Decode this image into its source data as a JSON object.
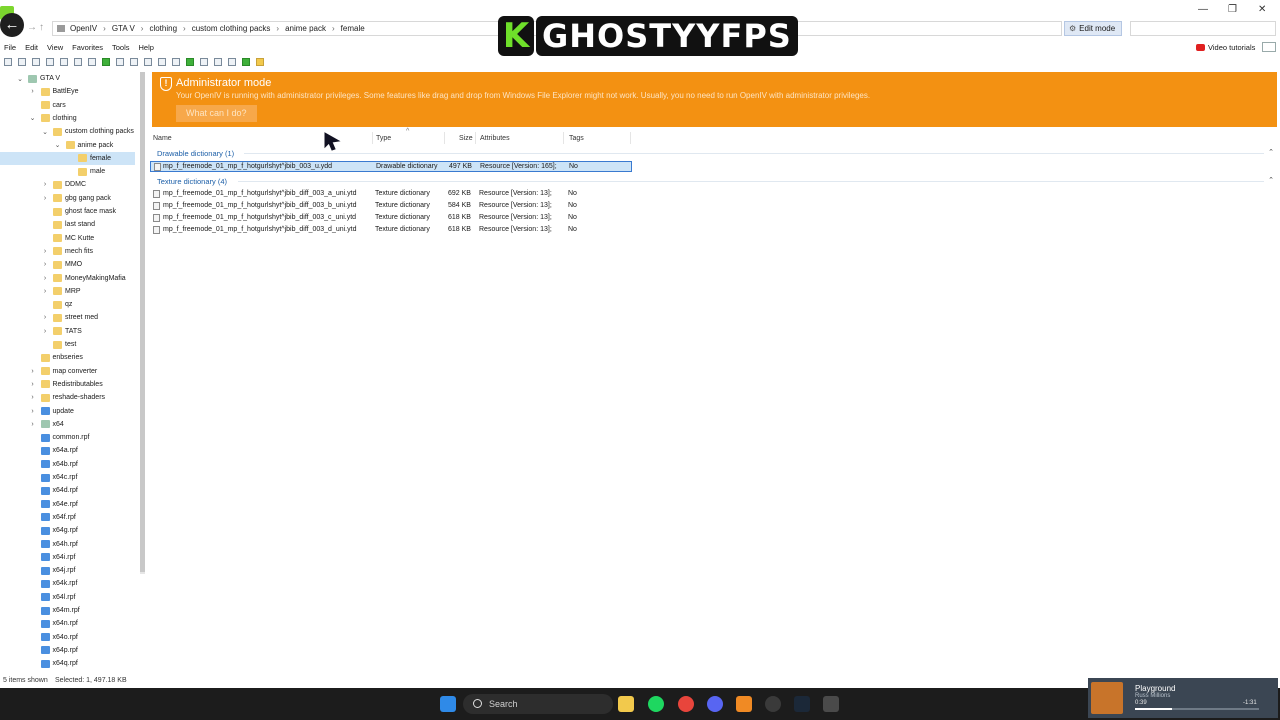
{
  "titlebar": {
    "breadcrumb": [
      "OpenIV",
      "GTA V",
      "clothing",
      "custom clothing packs",
      "anime pack",
      "female"
    ],
    "edit_mode": "Edit mode",
    "window_controls": [
      "—",
      "❐",
      "✕"
    ]
  },
  "watermark": {
    "logo_letter": "K",
    "text": "GHOSTYYFPS"
  },
  "menu": [
    "File",
    "Edit",
    "View",
    "Favorites",
    "Tools",
    "Help"
  ],
  "video_tutorials": "Video tutorials",
  "tree": [
    {
      "label": "GTA V",
      "depth": 0,
      "chev": "⌄",
      "kind": "sys"
    },
    {
      "label": "BattlEye",
      "depth": 1,
      "chev": "›",
      "kind": "folder"
    },
    {
      "label": "cars",
      "depth": 1,
      "chev": "",
      "kind": "folder"
    },
    {
      "label": "clothing",
      "depth": 1,
      "chev": "⌄",
      "kind": "folder"
    },
    {
      "label": "custom clothing packs",
      "depth": 2,
      "chev": "⌄",
      "kind": "folder"
    },
    {
      "label": "anime pack",
      "depth": 3,
      "chev": "⌄",
      "kind": "folder"
    },
    {
      "label": "female",
      "depth": 4,
      "chev": "",
      "kind": "folder",
      "selected": true
    },
    {
      "label": "male",
      "depth": 4,
      "chev": "",
      "kind": "folder"
    },
    {
      "label": "DDMC",
      "depth": 2,
      "chev": "›",
      "kind": "folder"
    },
    {
      "label": "gbg gang pack",
      "depth": 2,
      "chev": "›",
      "kind": "folder"
    },
    {
      "label": "ghost face mask",
      "depth": 2,
      "chev": "",
      "kind": "folder"
    },
    {
      "label": "last stand",
      "depth": 2,
      "chev": "",
      "kind": "folder"
    },
    {
      "label": "MC Kutte",
      "depth": 2,
      "chev": "",
      "kind": "folder"
    },
    {
      "label": "mech fits",
      "depth": 2,
      "chev": "›",
      "kind": "folder"
    },
    {
      "label": "MMO",
      "depth": 2,
      "chev": "›",
      "kind": "folder"
    },
    {
      "label": "MoneyMakingMafia",
      "depth": 2,
      "chev": "›",
      "kind": "folder"
    },
    {
      "label": "MRP",
      "depth": 2,
      "chev": "›",
      "kind": "folder"
    },
    {
      "label": "qz",
      "depth": 2,
      "chev": "",
      "kind": "folder"
    },
    {
      "label": "street med",
      "depth": 2,
      "chev": "›",
      "kind": "folder"
    },
    {
      "label": "TATS",
      "depth": 2,
      "chev": "›",
      "kind": "folder"
    },
    {
      "label": "test",
      "depth": 2,
      "chev": "",
      "kind": "folder"
    },
    {
      "label": "enbseries",
      "depth": 1,
      "chev": "",
      "kind": "folder"
    },
    {
      "label": "map converter",
      "depth": 1,
      "chev": "›",
      "kind": "folder"
    },
    {
      "label": "Redistributables",
      "depth": 1,
      "chev": "›",
      "kind": "folder"
    },
    {
      "label": "reshade-shaders",
      "depth": 1,
      "chev": "›",
      "kind": "folder"
    },
    {
      "label": "update",
      "depth": 1,
      "chev": "›",
      "kind": "blue"
    },
    {
      "label": "x64",
      "depth": 1,
      "chev": "›",
      "kind": "sys"
    },
    {
      "label": "common.rpf",
      "depth": 1,
      "chev": "",
      "kind": "blue"
    },
    {
      "label": "x64a.rpf",
      "depth": 1,
      "chev": "",
      "kind": "blue"
    },
    {
      "label": "x64b.rpf",
      "depth": 1,
      "chev": "",
      "kind": "blue"
    },
    {
      "label": "x64c.rpf",
      "depth": 1,
      "chev": "",
      "kind": "blue"
    },
    {
      "label": "x64d.rpf",
      "depth": 1,
      "chev": "",
      "kind": "blue"
    },
    {
      "label": "x64e.rpf",
      "depth": 1,
      "chev": "",
      "kind": "blue"
    },
    {
      "label": "x64f.rpf",
      "depth": 1,
      "chev": "",
      "kind": "blue"
    },
    {
      "label": "x64g.rpf",
      "depth": 1,
      "chev": "",
      "kind": "blue"
    },
    {
      "label": "x64h.rpf",
      "depth": 1,
      "chev": "",
      "kind": "blue"
    },
    {
      "label": "x64i.rpf",
      "depth": 1,
      "chev": "",
      "kind": "blue"
    },
    {
      "label": "x64j.rpf",
      "depth": 1,
      "chev": "",
      "kind": "blue"
    },
    {
      "label": "x64k.rpf",
      "depth": 1,
      "chev": "",
      "kind": "blue"
    },
    {
      "label": "x64l.rpf",
      "depth": 1,
      "chev": "",
      "kind": "blue"
    },
    {
      "label": "x64m.rpf",
      "depth": 1,
      "chev": "",
      "kind": "blue"
    },
    {
      "label": "x64n.rpf",
      "depth": 1,
      "chev": "",
      "kind": "blue"
    },
    {
      "label": "x64o.rpf",
      "depth": 1,
      "chev": "",
      "kind": "blue"
    },
    {
      "label": "x64p.rpf",
      "depth": 1,
      "chev": "",
      "kind": "blue"
    },
    {
      "label": "x64q.rpf",
      "depth": 1,
      "chev": "",
      "kind": "blue"
    }
  ],
  "banner": {
    "title": "Administrator mode",
    "text": "Your OpenIV is running with administrator privileges. Some features like drag and drop from Windows File Explorer might not work. Usually, you no need to run OpenIV with administrator privileges.",
    "button": "What can I do?",
    "color": "#f39112"
  },
  "list": {
    "columns": [
      "Name",
      "Type",
      "Size",
      "Attributes",
      "Tags"
    ],
    "groups": [
      {
        "title": "Drawable dictionary (1)",
        "rows": [
          {
            "name": "mp_f_freemode_01_mp_f_hotgurlshyt^jbib_003_u.ydd",
            "type": "Drawable dictionary",
            "size": "497 KB",
            "attributes": "Resource [Version: 165];",
            "tags": "No",
            "selected": true
          }
        ]
      },
      {
        "title": "Texture dictionary (4)",
        "rows": [
          {
            "name": "mp_f_freemode_01_mp_f_hotgurlshyt^jbib_diff_003_a_uni.ytd",
            "type": "Texture dictionary",
            "size": "692 KB",
            "attributes": "Resource [Version: 13];",
            "tags": "No"
          },
          {
            "name": "mp_f_freemode_01_mp_f_hotgurlshyt^jbib_diff_003_b_uni.ytd",
            "type": "Texture dictionary",
            "size": "584 KB",
            "attributes": "Resource [Version: 13];",
            "tags": "No"
          },
          {
            "name": "mp_f_freemode_01_mp_f_hotgurlshyt^jbib_diff_003_c_uni.ytd",
            "type": "Texture dictionary",
            "size": "618 KB",
            "attributes": "Resource [Version: 13];",
            "tags": "No"
          },
          {
            "name": "mp_f_freemode_01_mp_f_hotgurlshyt^jbib_diff_003_d_uni.ytd",
            "type": "Texture dictionary",
            "size": "618 KB",
            "attributes": "Resource [Version: 13];",
            "tags": "No"
          }
        ]
      }
    ]
  },
  "status": {
    "items_shown": "5 items shown",
    "selected": "Selected: 1,  497.18 KB"
  },
  "taskbar": {
    "search": "Search"
  },
  "media": {
    "title": "Playground",
    "artist": "Russ Millions",
    "elapsed": "0:39",
    "remaining": "-1:31",
    "progress": 0.3
  }
}
